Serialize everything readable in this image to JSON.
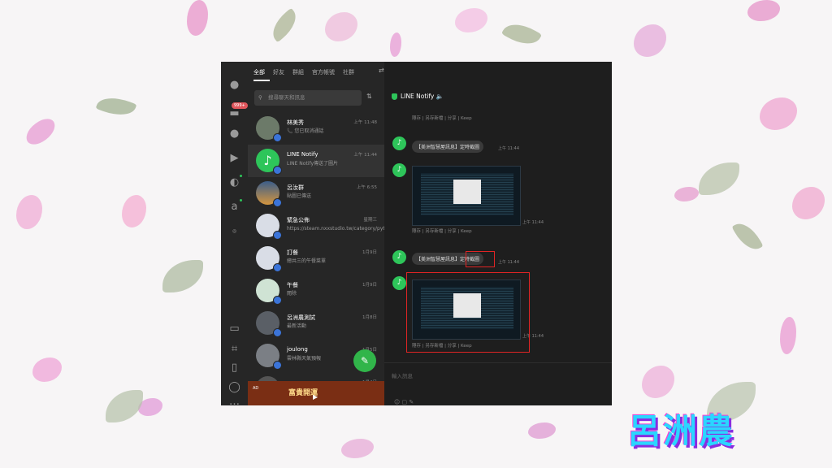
{
  "tabs": {
    "all": "全部",
    "friends": "好友",
    "groups": "群組",
    "official": "官方帳號",
    "community": "社群"
  },
  "rail_badge": "999+",
  "search": {
    "placeholder": "搜尋聊天和訊息"
  },
  "chats": [
    {
      "name": "林美秀",
      "sub": "📞 您已取消通話",
      "time": "上午 11:48"
    },
    {
      "name": "LINE Notify",
      "sub": "LINE Notify傳送了圖片",
      "time": "上午 11:44"
    },
    {
      "name": "呂汝群",
      "sub": "貼圖已傳送",
      "time": "上午 6:55"
    },
    {
      "name": "緊急公佈",
      "sub": "https://steam.nxxstudio.tw/category/python/pyqt6/op...",
      "time": "星期三"
    },
    {
      "name": "訂餐",
      "sub": "總共三的午餐菜單",
      "time": "1月9日"
    },
    {
      "name": "午餐",
      "sub": "閱除",
      "time": "1月9日"
    },
    {
      "name": "呂洲農測試",
      "sub": "最新活動",
      "time": "1月8日"
    },
    {
      "name": "joulong",
      "sub": "雲林縣天氣預報",
      "time": "1月5日"
    },
    {
      "name": "...",
      "sub": "",
      "time": "1月4日"
    }
  ],
  "ad": {
    "label": "AD",
    "text": "富貴開運"
  },
  "chat": {
    "title": "LINE Notify",
    "msg1": "【美洲智慧屋訊息】定時截圖",
    "msg2_prefix": "【美洲智慧屋訊息】",
    "msg2_highlight": "定時截圖",
    "time1": "上午 11:44",
    "time2": "上午 11:44",
    "time3": "上午 11:44",
    "time4": "上午 11:44",
    "actions": "隱存 | 另存新檔 | 分享 | Keep",
    "input_placeholder": "輸入訊息"
  },
  "watermark": "呂洲農"
}
